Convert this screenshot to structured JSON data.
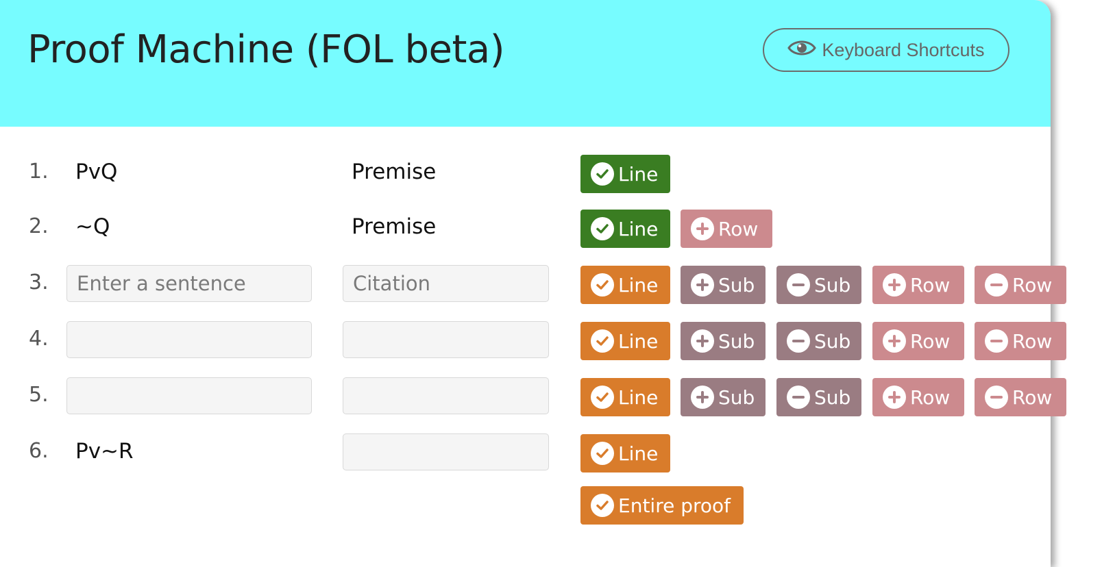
{
  "header": {
    "title": "Proof Machine (FOL beta)",
    "keyboard_shortcuts_label": "Keyboard Shortcuts",
    "keyboard_icon": "eye-icon",
    "background_color": "#77fcff"
  },
  "colors": {
    "line_checked": "#3a7d22",
    "line_unchecked": "#d97c2b",
    "sub": "#9a7c82",
    "row": "#cc8a8e"
  },
  "rows": [
    {
      "number": "1.",
      "sentence": "PvQ",
      "citation": "Premise"
    },
    {
      "number": "2.",
      "sentence": "~Q",
      "citation": "Premise"
    },
    {
      "number": "3.",
      "sentence_placeholder": "Enter a sentence",
      "citation_placeholder": "Citation",
      "sentence": "",
      "citation": ""
    },
    {
      "number": "4.",
      "sentence": "",
      "citation": ""
    },
    {
      "number": "5.",
      "sentence": "",
      "citation": ""
    },
    {
      "number": "6.",
      "sentence": "Pv~R",
      "citation": ""
    }
  ],
  "buttons": {
    "line": "Line",
    "sub": "Sub",
    "row": "Row",
    "entire_proof": "Entire proof"
  }
}
